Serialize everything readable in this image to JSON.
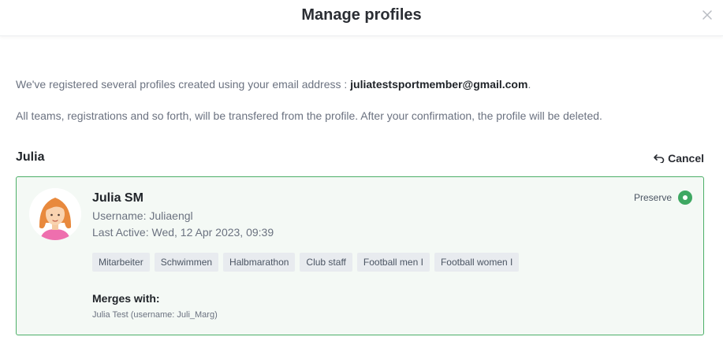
{
  "dialog": {
    "title": "Manage profiles",
    "close_icon": "close-icon"
  },
  "intro": {
    "line1_prefix": "We've registered several profiles created using your email address : ",
    "email": "juliatestsportmember@gmail.com",
    "line1_suffix": ".",
    "line2": "All teams, registrations and so forth, will be transfered from the profile. After your confirmation, the profile will be deleted."
  },
  "group": {
    "name": "Julia",
    "cancel_label": "Cancel",
    "cancel_icon": "undo-arrow-icon"
  },
  "profile": {
    "name": "Julia SM",
    "username": "Username: Juliaengl",
    "last_active": "Last Active: Wed, 12 Apr 2023, 09:39",
    "preserve_label": "Preserve",
    "preserve_selected": true,
    "tags": [
      "Mitarbeiter",
      "Schwimmen",
      "Halbmarathon",
      "Club staff",
      "Football men I",
      "Football women I"
    ],
    "merges_label": "Merges with:",
    "merges": [
      "Julia Test (username: Juli_Marg)"
    ]
  },
  "colors": {
    "accent_green": "#3ea862",
    "card_border": "#4caf68",
    "card_bg": "#f4f9f5",
    "tag_bg": "#e8ebef"
  }
}
